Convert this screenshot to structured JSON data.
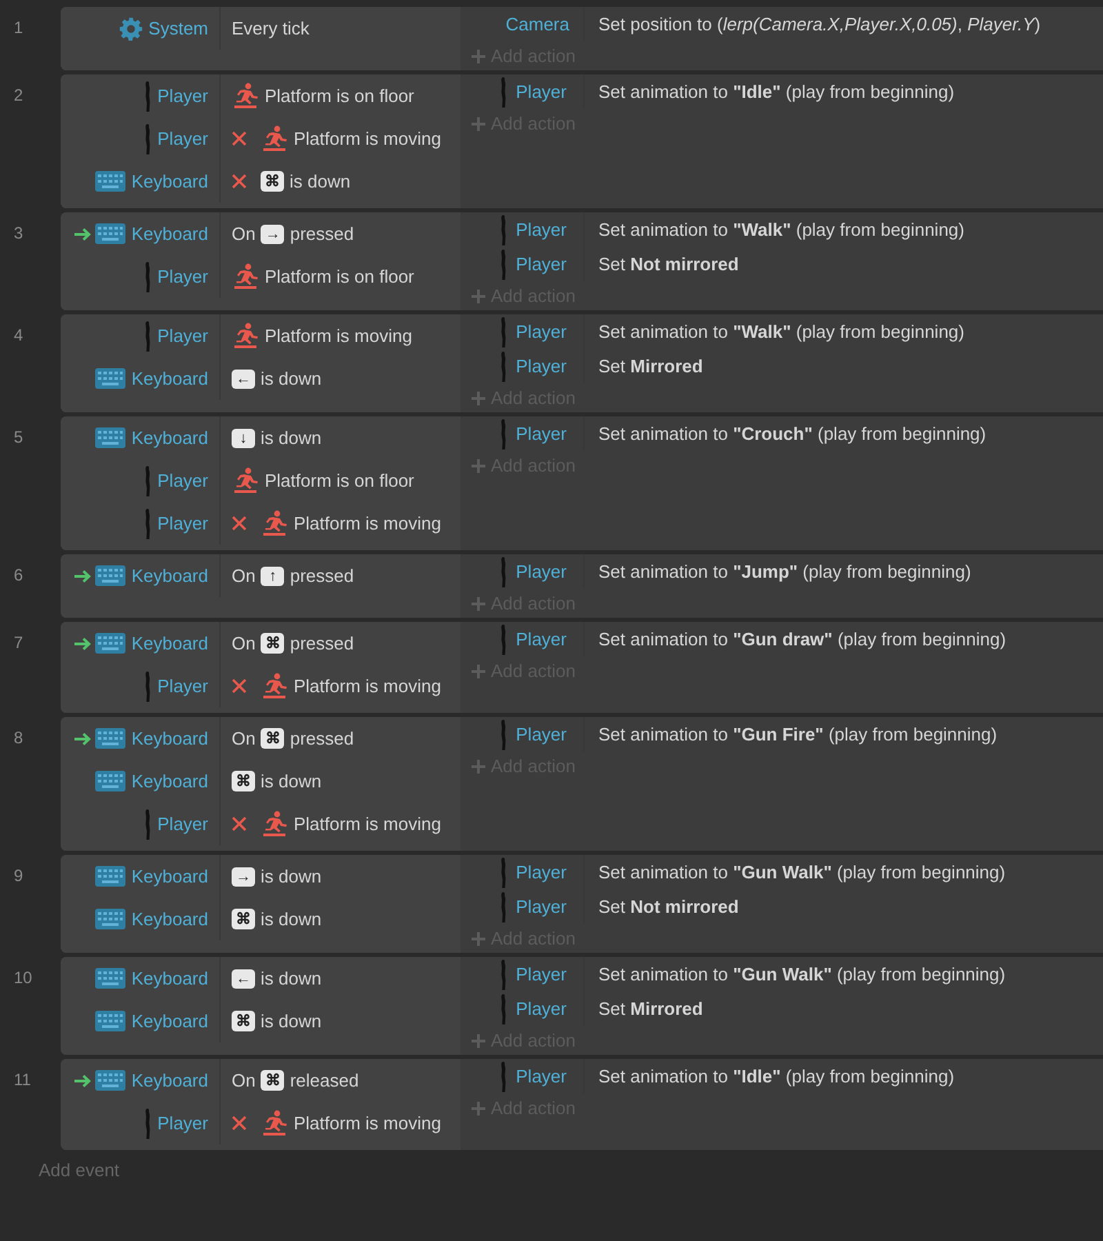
{
  "events": [
    {
      "number": "1",
      "conditions": [
        {
          "object": "System",
          "kind": "system",
          "trigger": false,
          "inverted": false,
          "text": "Every tick"
        }
      ],
      "actions": [
        {
          "object": "Camera",
          "kind": "plain",
          "text": "Set position to (*lerp(Camera.X,Player.X,0.05)*, *Player.Y*)"
        }
      ],
      "add_action": "Add action"
    },
    {
      "number": "2",
      "conditions": [
        {
          "object": "Player",
          "kind": "sprite",
          "trigger": false,
          "inverted": false,
          "text": "Platform is on floor"
        },
        {
          "object": "Player",
          "kind": "sprite",
          "trigger": false,
          "inverted": true,
          "text": "Platform is moving"
        },
        {
          "object": "Keyboard",
          "kind": "keyboard",
          "trigger": false,
          "inverted": true,
          "key": "⌘",
          "text": "is down"
        }
      ],
      "actions": [
        {
          "object": "Player",
          "kind": "sprite",
          "text": "Set animation to **\"Idle\"** (play from beginning)"
        }
      ],
      "add_action": "Add action"
    },
    {
      "number": "3",
      "conditions": [
        {
          "object": "Keyboard",
          "kind": "keyboard",
          "trigger": true,
          "inverted": false,
          "prefix": "On",
          "key": "→",
          "text": "pressed"
        },
        {
          "object": "Player",
          "kind": "sprite",
          "trigger": false,
          "inverted": false,
          "text": "Platform is on floor"
        }
      ],
      "actions": [
        {
          "object": "Player",
          "kind": "sprite",
          "text": "Set animation to **\"Walk\"** (play from beginning)"
        },
        {
          "object": "Player",
          "kind": "sprite",
          "text": "Set **Not mirrored**"
        }
      ],
      "add_action": "Add action"
    },
    {
      "number": "4",
      "conditions": [
        {
          "object": "Player",
          "kind": "sprite",
          "trigger": false,
          "inverted": false,
          "text": "Platform is moving"
        },
        {
          "object": "Keyboard",
          "kind": "keyboard",
          "trigger": false,
          "inverted": false,
          "key": "←",
          "text": "is down"
        }
      ],
      "actions": [
        {
          "object": "Player",
          "kind": "sprite",
          "text": "Set animation to **\"Walk\"** (play from beginning)"
        },
        {
          "object": "Player",
          "kind": "sprite",
          "text": "Set **Mirrored**"
        }
      ],
      "add_action": "Add action"
    },
    {
      "number": "5",
      "conditions": [
        {
          "object": "Keyboard",
          "kind": "keyboard",
          "trigger": false,
          "inverted": false,
          "key": "↓",
          "text": "is down"
        },
        {
          "object": "Player",
          "kind": "sprite",
          "trigger": false,
          "inverted": false,
          "text": "Platform is on floor"
        },
        {
          "object": "Player",
          "kind": "sprite",
          "trigger": false,
          "inverted": true,
          "text": "Platform is moving"
        }
      ],
      "actions": [
        {
          "object": "Player",
          "kind": "sprite",
          "text": "Set animation to **\"Crouch\"** (play from beginning)"
        }
      ],
      "add_action": "Add action"
    },
    {
      "number": "6",
      "conditions": [
        {
          "object": "Keyboard",
          "kind": "keyboard",
          "trigger": true,
          "inverted": false,
          "prefix": "On",
          "key": "↑",
          "text": "pressed"
        }
      ],
      "actions": [
        {
          "object": "Player",
          "kind": "sprite",
          "text": "Set animation to **\"Jump\"** (play from beginning)"
        }
      ],
      "add_action": "Add action"
    },
    {
      "number": "7",
      "conditions": [
        {
          "object": "Keyboard",
          "kind": "keyboard",
          "trigger": true,
          "inverted": false,
          "prefix": "On",
          "key": "⌘",
          "text": "pressed"
        },
        {
          "object": "Player",
          "kind": "sprite",
          "trigger": false,
          "inverted": true,
          "text": "Platform is moving"
        }
      ],
      "actions": [
        {
          "object": "Player",
          "kind": "sprite",
          "text": "Set animation to **\"Gun draw\"** (play from beginning)"
        }
      ],
      "add_action": "Add action"
    },
    {
      "number": "8",
      "conditions": [
        {
          "object": "Keyboard",
          "kind": "keyboard",
          "trigger": true,
          "inverted": false,
          "prefix": "On",
          "key": "⌘",
          "text": "pressed"
        },
        {
          "object": "Keyboard",
          "kind": "keyboard",
          "trigger": false,
          "inverted": false,
          "key": "⌘",
          "text": "is down"
        },
        {
          "object": "Player",
          "kind": "sprite",
          "trigger": false,
          "inverted": true,
          "text": "Platform is moving"
        }
      ],
      "actions": [
        {
          "object": "Player",
          "kind": "sprite",
          "text": "Set animation to **\"Gun Fire\"** (play from beginning)"
        }
      ],
      "add_action": "Add action"
    },
    {
      "number": "9",
      "conditions": [
        {
          "object": "Keyboard",
          "kind": "keyboard",
          "trigger": false,
          "inverted": false,
          "key": "→",
          "text": "is down"
        },
        {
          "object": "Keyboard",
          "kind": "keyboard",
          "trigger": false,
          "inverted": false,
          "key": "⌘",
          "text": "is down"
        }
      ],
      "actions": [
        {
          "object": "Player",
          "kind": "sprite",
          "text": "Set animation to **\"Gun Walk\"** (play from beginning)"
        },
        {
          "object": "Player",
          "kind": "sprite",
          "text": "Set **Not mirrored**"
        }
      ],
      "add_action": "Add action"
    },
    {
      "number": "10",
      "conditions": [
        {
          "object": "Keyboard",
          "kind": "keyboard",
          "trigger": false,
          "inverted": false,
          "key": "←",
          "text": "is down"
        },
        {
          "object": "Keyboard",
          "kind": "keyboard",
          "trigger": false,
          "inverted": false,
          "key": "⌘",
          "text": "is down"
        }
      ],
      "actions": [
        {
          "object": "Player",
          "kind": "sprite",
          "text": "Set animation to **\"Gun Walk\"** (play from beginning)"
        },
        {
          "object": "Player",
          "kind": "sprite",
          "text": "Set **Mirrored**"
        }
      ],
      "add_action": "Add action"
    },
    {
      "number": "11",
      "conditions": [
        {
          "object": "Keyboard",
          "kind": "keyboard",
          "trigger": true,
          "inverted": false,
          "prefix": "On",
          "key": "⌘",
          "text": "released"
        },
        {
          "object": "Player",
          "kind": "sprite",
          "trigger": false,
          "inverted": true,
          "text": "Platform is moving"
        }
      ],
      "actions": [
        {
          "object": "Player",
          "kind": "sprite",
          "text": "Set animation to **\"Idle\"** (play from beginning)"
        }
      ],
      "add_action": "Add action"
    }
  ],
  "add_event": "Add event"
}
